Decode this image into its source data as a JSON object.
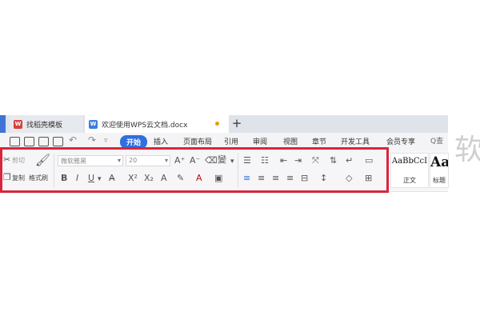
{
  "tabs": [
    {
      "label": "找稻壳模板",
      "icon": "docer-icon"
    },
    {
      "label": "欢迎使用WPS云文档.docx",
      "icon": "wps-doc-icon",
      "active": true
    }
  ],
  "new_tab": "+",
  "menu": {
    "items": [
      "开始",
      "插入",
      "页面布局",
      "引用",
      "审阅",
      "视图",
      "章节",
      "开发工具",
      "会员专享"
    ],
    "active": "开始",
    "search": "Q查"
  },
  "clipboard": {
    "cut": "剪切",
    "copy": "复制",
    "format_painter": "格式刷"
  },
  "font": {
    "family_placeholder": "微软雅黑",
    "size": "20"
  },
  "styles": [
    {
      "sample": "AaBbCcI",
      "name": "正文"
    },
    {
      "sample": "Aa",
      "name": "标题"
    }
  ],
  "watermark": "软",
  "colors": {
    "accent": "#2f6fe0",
    "highlight": "#d7263d",
    "tab_bar": "#dfe3ea"
  }
}
